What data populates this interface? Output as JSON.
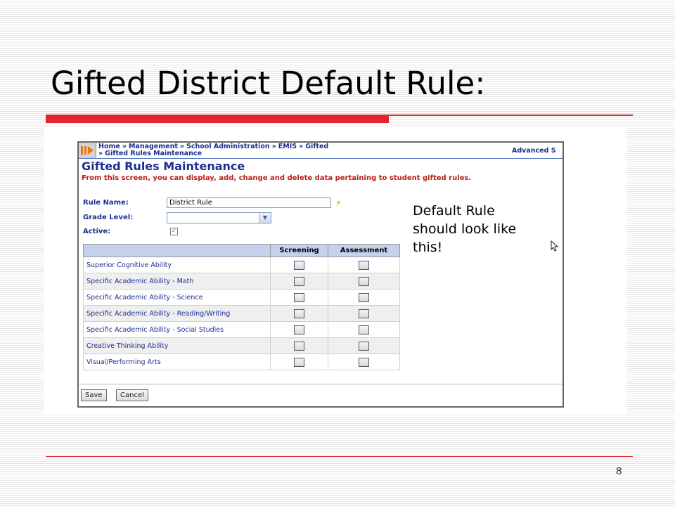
{
  "slide": {
    "title": "Gifted District Default Rule:",
    "page_number": "8",
    "note_line1": "Default Rule",
    "note_line2": "should look like",
    "note_line3": "this!"
  },
  "app": {
    "breadcrumb": {
      "line1": [
        "Home",
        "Management",
        "School Administration",
        "EMIS",
        "Gifted"
      ],
      "line2": "Gifted Rules Maintenance",
      "separator": "»",
      "advanced_search": "Advanced S"
    },
    "heading": "Gifted Rules Maintenance",
    "description": "From this screen, you can display, add, change and delete data pertaining to student gifted rules.",
    "form": {
      "rule_name_label": "Rule Name:",
      "rule_name_value": "District Rule",
      "grade_level_label": "Grade Level:",
      "grade_level_value": "",
      "active_label": "Active:",
      "active_checked": true
    },
    "table": {
      "columns": [
        "",
        "Screening",
        "Assessment"
      ],
      "rows": [
        {
          "name": "Superior Cognitive Ability",
          "screening": false,
          "assessment": false
        },
        {
          "name": "Specific Academic Ability - Math",
          "screening": false,
          "assessment": false
        },
        {
          "name": "Specific Academic Ability - Science",
          "screening": false,
          "assessment": false
        },
        {
          "name": "Specific Academic Ability - Reading/Writing",
          "screening": false,
          "assessment": false
        },
        {
          "name": "Specific Academic Ability - Social Studies",
          "screening": false,
          "assessment": false
        },
        {
          "name": "Creative Thinking Ability",
          "screening": false,
          "assessment": false
        },
        {
          "name": "Visual/Performing Arts",
          "screening": false,
          "assessment": false
        }
      ]
    },
    "buttons": {
      "save": "Save",
      "cancel": "Cancel"
    }
  },
  "colors": {
    "accent_red": "#e3262c",
    "app_blue": "#1a2f8f",
    "header_blue": "#c3d1ec",
    "desc_red": "#b52019"
  },
  "icons": [
    "logo-icon",
    "lightning-icon",
    "chevron-down-icon",
    "checkmark-icon",
    "cursor-icon"
  ]
}
